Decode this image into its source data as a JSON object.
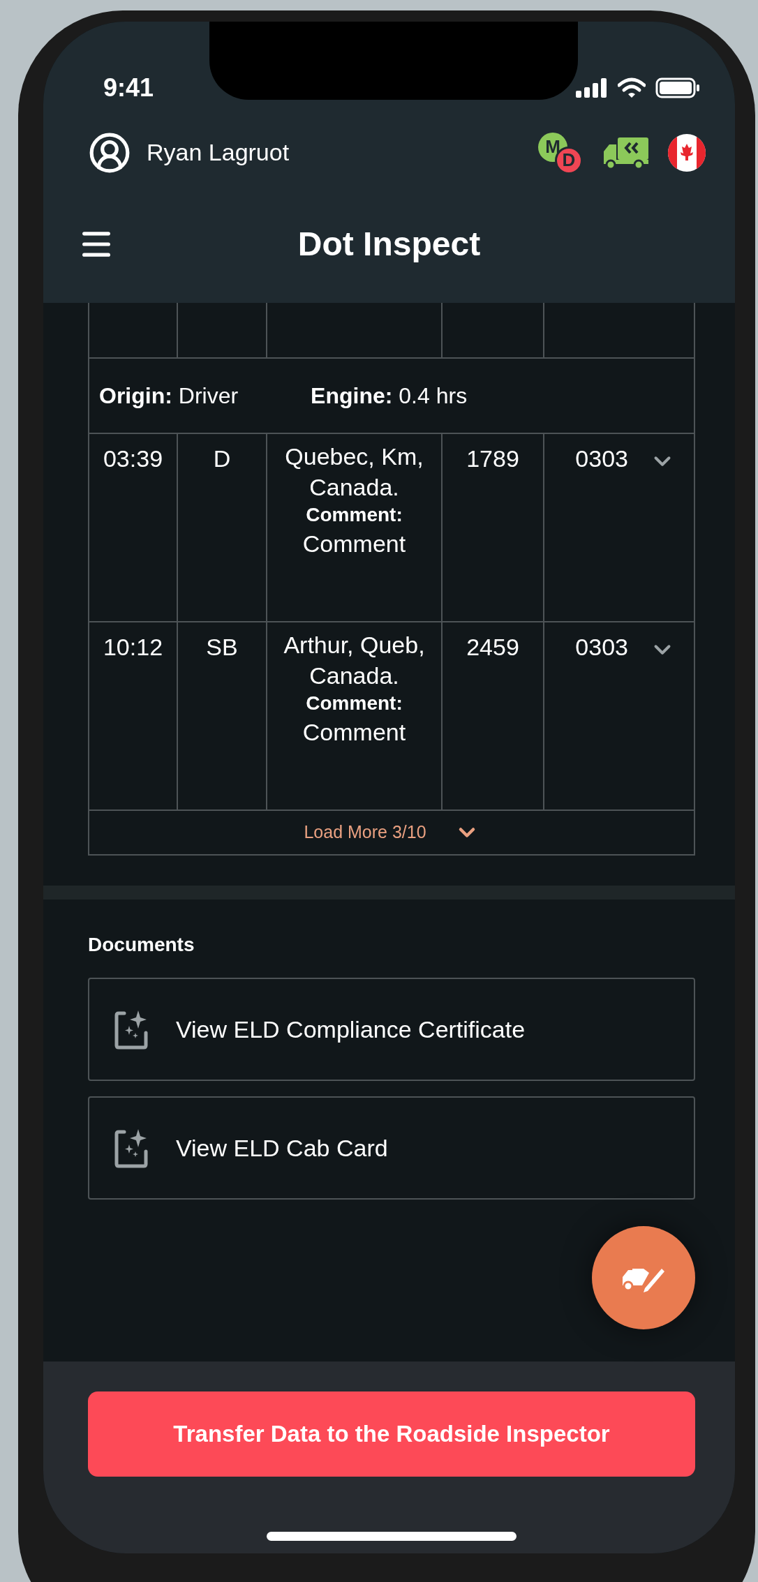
{
  "status_bar": {
    "time": "9:41"
  },
  "header": {
    "user_name": "Ryan Lagruot",
    "badge_letters": [
      {
        "letter": "M",
        "color": "#8cc95a"
      },
      {
        "letter": "D",
        "color": "#f04654"
      }
    ],
    "title": "Dot Inspect"
  },
  "log_table": {
    "summary": [
      "**Origin:** Driver",
      "**Engine:** 0.4 hrs"
    ],
    "rows": [
      {
        "time": "03:39",
        "status": "D",
        "location": "Quebec, Km, Canada.",
        "comment_label": "Comment:",
        "comment": "Comment",
        "odometer": "1789",
        "code": "0303"
      },
      {
        "time": "10:12",
        "status": "SB",
        "location": "Arthur, Queb, Canada.",
        "comment_label": "Comment:",
        "comment": "Comment",
        "odometer": "2459",
        "code": "0303"
      }
    ],
    "load_more": "Load More 3/10"
  },
  "documents": {
    "title": "Documents",
    "items": [
      "View ELD Compliance Certificate",
      "View ELD Cab Card"
    ]
  },
  "transfer_button": "Transfer Data to the Roadside Inspector"
}
